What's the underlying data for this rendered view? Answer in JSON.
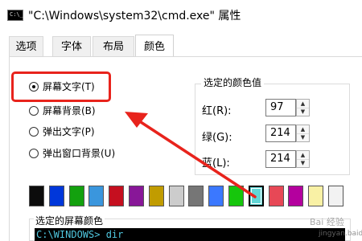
{
  "window": {
    "title": "\"C:\\Windows\\system32\\cmd.exe\" 属性",
    "icon": "cmd-icon",
    "icon_text": "C:\\_"
  },
  "tabs": [
    {
      "label": "选项",
      "active": false
    },
    {
      "label": "字体",
      "active": false
    },
    {
      "label": "布局",
      "active": false
    },
    {
      "label": "颜色",
      "active": true
    }
  ],
  "radios": [
    {
      "label": "屏幕文字(T)",
      "checked": true
    },
    {
      "label": "屏幕背景(B)",
      "checked": false
    },
    {
      "label": "弹出文字(P)",
      "checked": false
    },
    {
      "label": "弹出窗口背景(U)",
      "checked": false
    }
  ],
  "selected_color": {
    "group_title": "选定的颜色值",
    "red_label": "红(R):",
    "red_value": "97",
    "green_label": "绿(G):",
    "green_value": "214",
    "blue_label": "蓝(L):",
    "blue_value": "214"
  },
  "palette": {
    "colors": [
      "#0c0c0c",
      "#0037da",
      "#13a10e",
      "#3a96dd",
      "#c50f1f",
      "#881798",
      "#c19c00",
      "#cccccc",
      "#767676",
      "#3b78ff",
      "#16c60c",
      "#61d6d6",
      "#e74856",
      "#b4009e",
      "#f9f1a5",
      "#f2f2f2"
    ],
    "selected_index": 11
  },
  "screen_colors": {
    "title": "选定的屏幕颜色",
    "preview_text": "C:\\WINDOWS> dir"
  },
  "annotation": {
    "highlight_color": "#e8231c",
    "arrow_color": "#e8231c"
  },
  "watermark": {
    "logo_text": "Bai 经验",
    "site": "jingyan.baidu"
  }
}
